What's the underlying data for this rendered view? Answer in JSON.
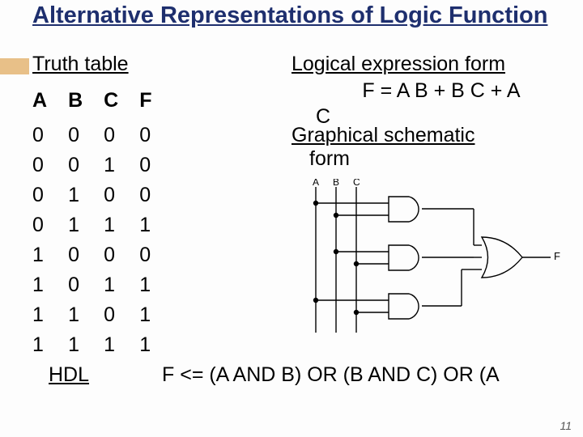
{
  "page": {
    "title": "Alternative Representations of Logic Function",
    "page_number": "11"
  },
  "truth_table": {
    "label": "Truth table",
    "headers": [
      "A",
      "B",
      "C",
      "F"
    ],
    "rows": [
      [
        "0",
        "0",
        "0",
        "0"
      ],
      [
        "0",
        "0",
        "1",
        "0"
      ],
      [
        "0",
        "1",
        "0",
        "0"
      ],
      [
        "0",
        "1",
        "1",
        "1"
      ],
      [
        "1",
        "0",
        "0",
        "0"
      ],
      [
        "1",
        "0",
        "1",
        "1"
      ],
      [
        "1",
        "1",
        "0",
        "1"
      ],
      [
        "1",
        "1",
        "1",
        "1"
      ]
    ]
  },
  "expression": {
    "label": "Logical expression form",
    "formula_line1": "F = A B + B C + A",
    "formula_line2": "C"
  },
  "schematic": {
    "label": "Graphical schematic",
    "form": "form",
    "inputs": [
      "A",
      "B",
      "C"
    ],
    "output": "F",
    "gates": [
      "AND",
      "AND",
      "AND",
      "OR"
    ]
  },
  "hdl": {
    "label": "HDL",
    "code": "F  <=  (A AND B) OR (B AND C) OR (A"
  }
}
